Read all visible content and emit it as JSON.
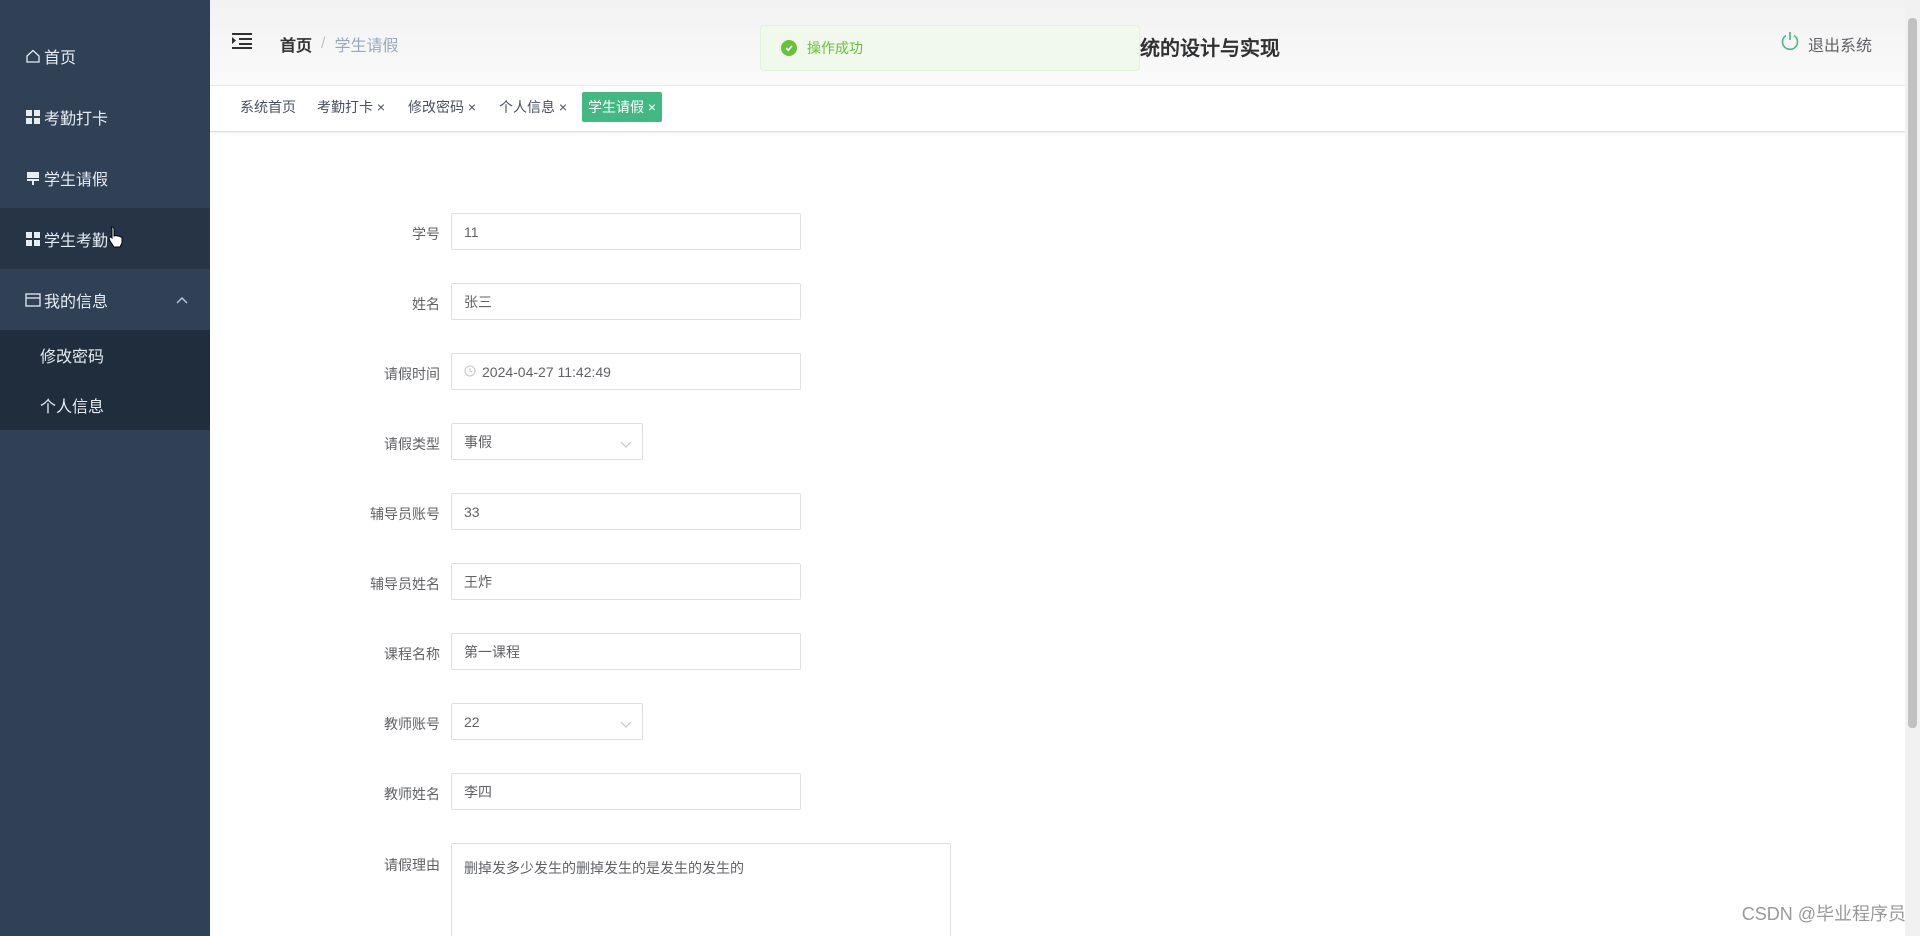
{
  "sidebar": {
    "items": [
      {
        "label": "首页",
        "icon": "home-icon"
      },
      {
        "label": "考勤打卡",
        "icon": "grid-icon"
      },
      {
        "label": "学生请假",
        "icon": "flag-icon"
      },
      {
        "label": "学生考勤",
        "icon": "grid-icon"
      },
      {
        "label": "我的信息",
        "icon": "card-icon"
      }
    ],
    "submenu": [
      {
        "label": "修改密码"
      },
      {
        "label": "个人信息"
      }
    ]
  },
  "header": {
    "breadcrumb_home": "首页",
    "breadcrumb_sep": "/",
    "breadcrumb_current": "学生请假",
    "title": "统的设计与实现",
    "logout_label": "退出系统"
  },
  "toast": {
    "message": "操作成功",
    "color": "#67c23a"
  },
  "tags": [
    {
      "label": "系统首页"
    },
    {
      "label": "考勤打卡 ×"
    },
    {
      "label": "修改密码 ×"
    },
    {
      "label": "个人信息 ×"
    },
    {
      "label": "学生请假 ×",
      "active": true
    }
  ],
  "form": {
    "student_no": {
      "label": "学号",
      "value": "11"
    },
    "name": {
      "label": "姓名",
      "value": "张三"
    },
    "leave_time": {
      "label": "请假时间",
      "value": "2024-04-27 11:42:49"
    },
    "leave_type": {
      "label": "请假类型",
      "value": "事假"
    },
    "counselor_no": {
      "label": "辅导员账号",
      "value": "33"
    },
    "counselor_name": {
      "label": "辅导员姓名",
      "value": "王炸"
    },
    "course_name": {
      "label": "课程名称",
      "value": "第一课程"
    },
    "teacher_no": {
      "label": "教师账号",
      "value": "22"
    },
    "teacher_name": {
      "label": "教师姓名",
      "value": "李四"
    },
    "reason": {
      "label": "请假理由",
      "value": "删掉发多少发生的删掉发生的是发生的发生的"
    }
  },
  "watermark": "CSDN @毕业程序员",
  "colors": {
    "sidebar_bg": "#304156",
    "accent": "#42b983"
  }
}
